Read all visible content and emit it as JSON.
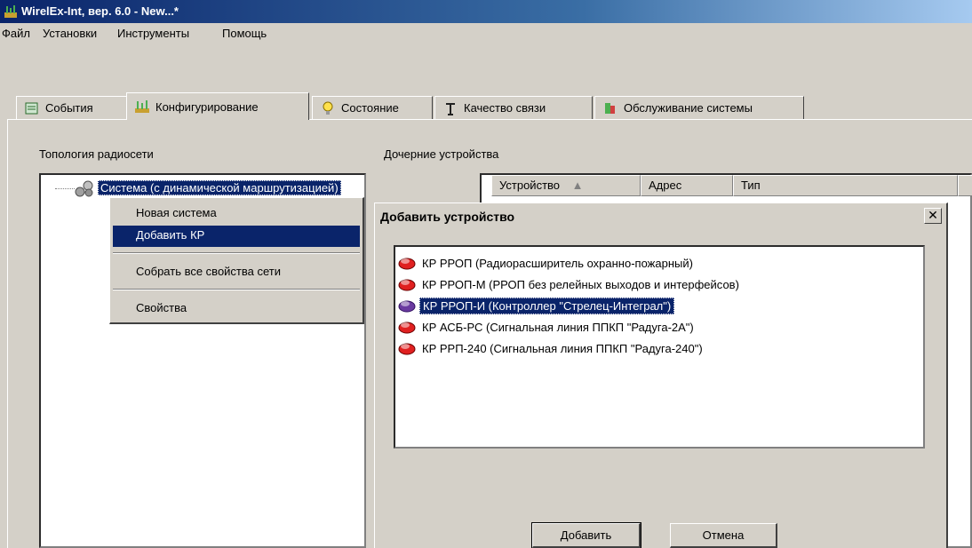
{
  "window": {
    "title": "WirelEx-Int, вер. 6.0 - New...*"
  },
  "menu": [
    "Файл",
    "Установки",
    "Инструменты",
    "Помощь"
  ],
  "tabs": [
    {
      "label": "События",
      "icon": "notes-icon"
    },
    {
      "label": "Конфигурирование",
      "icon": "config-icon"
    },
    {
      "label": "Состояние",
      "icon": "bulb-icon"
    },
    {
      "label": "Качество связи",
      "icon": "antenna-icon"
    },
    {
      "label": "Обслуживание системы",
      "icon": "service-icon"
    }
  ],
  "active_tab": "Конфигурирование",
  "left_panel": {
    "label": "Топология радиосети",
    "tree_root": "Система (с динамической маршрутизацией)"
  },
  "right_panel": {
    "label": "Дочерние устройства",
    "columns": [
      "Устройство",
      "Адрес",
      "Тип"
    ]
  },
  "context_menu": {
    "items": [
      "Новая система",
      "Добавить КР",
      "Собрать все свойства сети",
      "Свойства"
    ],
    "selected": "Добавить КР"
  },
  "dialog": {
    "title": "Добавить устройство",
    "close_label": "✕",
    "devices": [
      "КР РРОП (Радиорасширитель охранно-пожарный)",
      "КР РРОП-М (РРОП без релейных выходов и интерфейсов)",
      "КР РРОП-И (Контроллер \"Стрелец-Интеграл\")",
      "КР АСБ-РС (Сигнальная линия ППКП \"Радуга-2А\")",
      "КР РРП-240 (Сигнальная линия ППКП \"Радуга-240\")"
    ],
    "selected_device": "КР РРОП-И (Контроллер \"Стрелец-Интеграл\")",
    "add_button": "Добавить",
    "cancel_button": "Отмена"
  }
}
